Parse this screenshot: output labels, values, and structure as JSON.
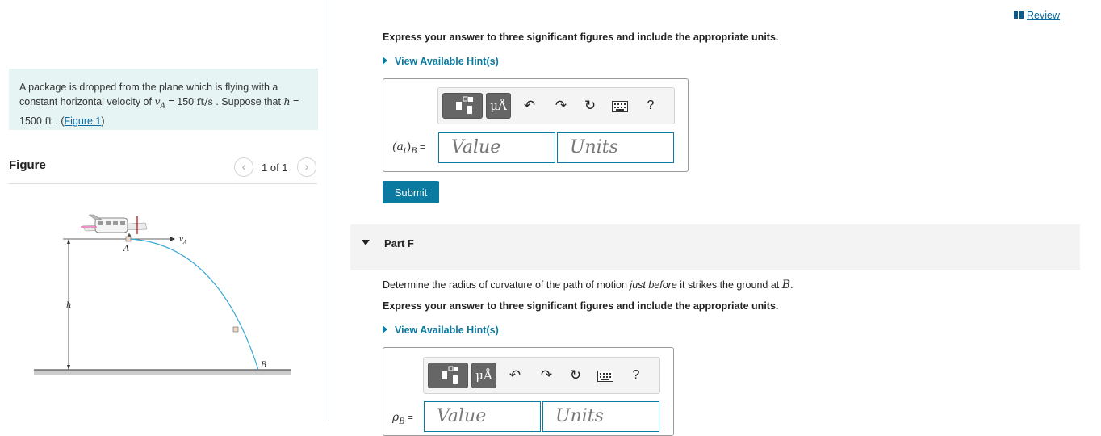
{
  "review": {
    "label": "Review"
  },
  "problem": {
    "text1": "A package is dropped from the plane which is flying with a constant horizontal velocity of ",
    "va_sym": "v",
    "va_sub": "A",
    "va_val": " = 150 ",
    "va_unit": "ft/s",
    "text2": " . Suppose that ",
    "h_sym": "h",
    "h_val": " = 1500 ",
    "h_unit": "ft",
    "text3": " . (",
    "fig_link": "Figure 1",
    "text4": ")"
  },
  "figure": {
    "title": "Figure",
    "pager": "1 of 1",
    "labels": {
      "a": "A",
      "va": "v",
      "va_sub": "A",
      "h": "h",
      "b": "B"
    }
  },
  "part_e": {
    "instruction": "Express your answer to three significant figures and include the appropriate units.",
    "hint": "View Available Hint(s)",
    "var_label": "(a",
    "var_sub": "t",
    "var_close": ")",
    "var_sub2": "B",
    "var_eq": " =",
    "value_placeholder": "Value",
    "units_placeholder": "Units",
    "submit": "Submit",
    "toolbar": {
      "mu": "μÅ",
      "help": "?"
    }
  },
  "part_f": {
    "label": "Part F",
    "desc1": "Determine the radius of curvature of the path of motion ",
    "desc_it": "just before",
    "desc2": " it strikes the ground at ",
    "desc_b": "B",
    "desc3": ".",
    "instruction": "Express your answer to three significant figures and include the appropriate units.",
    "hint": "View Available Hint(s)",
    "var_label": "ρ",
    "var_sub": "B",
    "var_eq": " =",
    "value_placeholder": "Value",
    "units_placeholder": "Units",
    "toolbar": {
      "mu": "μÅ",
      "help": "?"
    }
  },
  "colors": {
    "accent": "#0a7aa1",
    "problem_bg": "#e6f4f4",
    "trajectory": "#3aa8d8"
  }
}
